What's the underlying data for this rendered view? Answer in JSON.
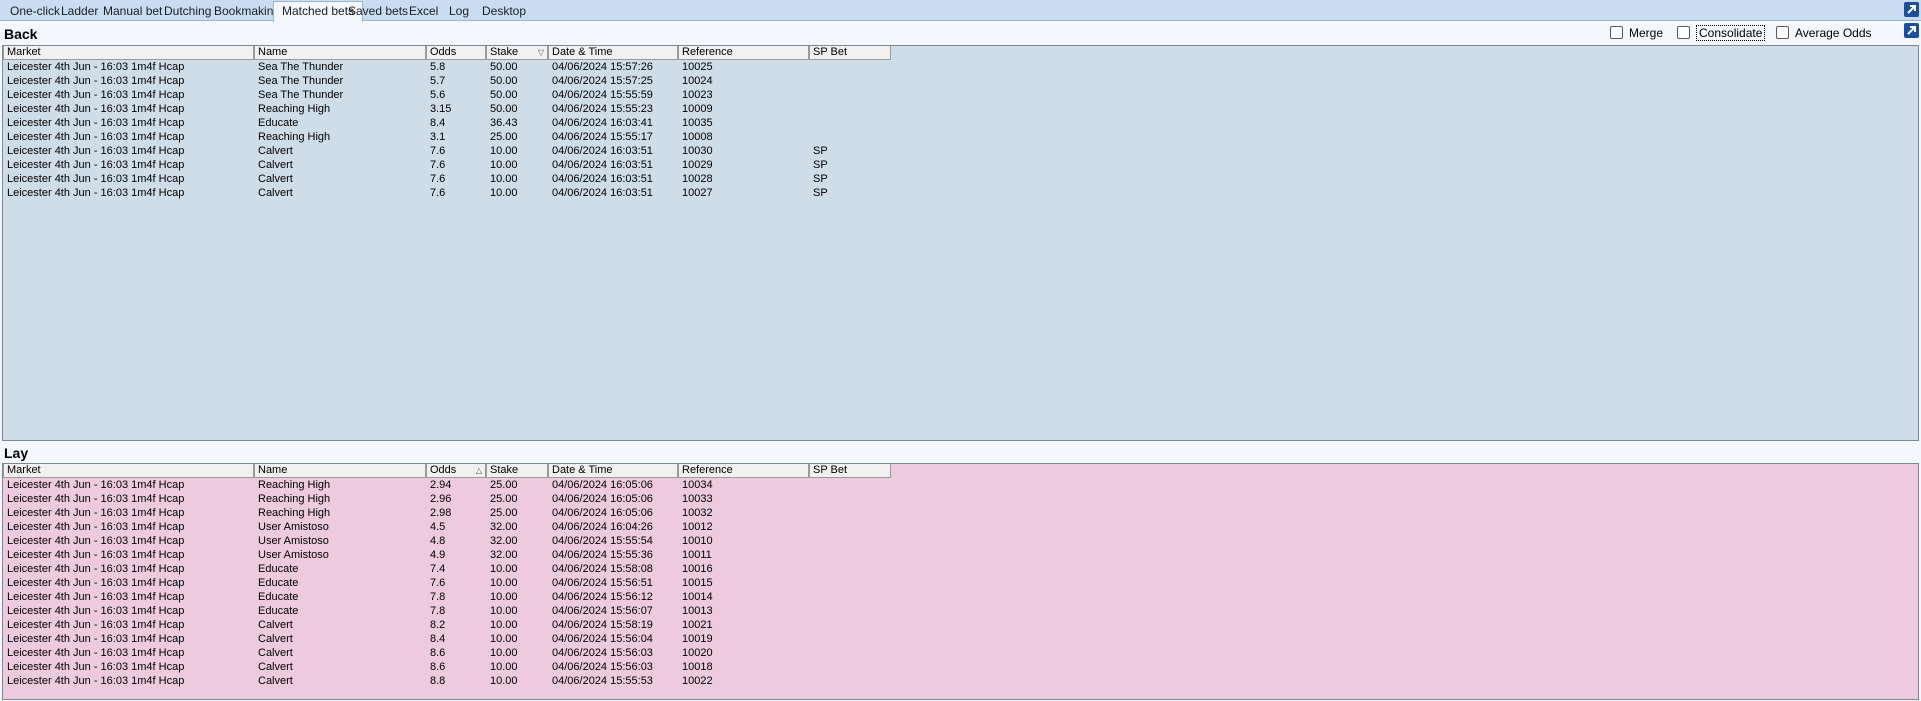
{
  "tabs": [
    {
      "label": "One-click",
      "active": false
    },
    {
      "label": "Ladder",
      "active": false
    },
    {
      "label": "Manual bet",
      "active": false
    },
    {
      "label": "Dutching",
      "active": false
    },
    {
      "label": "Bookmaking",
      "active": false
    },
    {
      "label": "Matched bets",
      "active": true
    },
    {
      "label": "Saved bets",
      "active": false
    },
    {
      "label": "Excel",
      "active": false
    },
    {
      "label": "Log",
      "active": false
    },
    {
      "label": "Desktop",
      "active": false
    }
  ],
  "options": {
    "merge": "Merge",
    "consolidate": "Consolidate",
    "average_odds": "Average Odds"
  },
  "columns": [
    "Market",
    "Name",
    "Odds",
    "Stake",
    "Date & Time",
    "Reference",
    "SP Bet"
  ],
  "back": {
    "title": "Back",
    "sort_column": "Stake",
    "rows": [
      [
        "Leicester 4th Jun - 16:03 1m4f Hcap",
        "Sea The Thunder",
        "5.8",
        "50.00",
        "04/06/2024 15:57:26",
        "10025",
        ""
      ],
      [
        "Leicester 4th Jun - 16:03 1m4f Hcap",
        "Sea The Thunder",
        "5.7",
        "50.00",
        "04/06/2024 15:57:25",
        "10024",
        ""
      ],
      [
        "Leicester 4th Jun - 16:03 1m4f Hcap",
        "Sea The Thunder",
        "5.6",
        "50.00",
        "04/06/2024 15:55:59",
        "10023",
        ""
      ],
      [
        "Leicester 4th Jun - 16:03 1m4f Hcap",
        "Reaching High",
        "3.15",
        "50.00",
        "04/06/2024 15:55:23",
        "10009",
        ""
      ],
      [
        "Leicester 4th Jun - 16:03 1m4f Hcap",
        "Educate",
        "8.4",
        "36.43",
        "04/06/2024 16:03:41",
        "10035",
        ""
      ],
      [
        "Leicester 4th Jun - 16:03 1m4f Hcap",
        "Reaching High",
        "3.1",
        "25.00",
        "04/06/2024 15:55:17",
        "10008",
        ""
      ],
      [
        "Leicester 4th Jun - 16:03 1m4f Hcap",
        "Calvert",
        "7.6",
        "10.00",
        "04/06/2024 16:03:51",
        "10030",
        "SP"
      ],
      [
        "Leicester 4th Jun - 16:03 1m4f Hcap",
        "Calvert",
        "7.6",
        "10.00",
        "04/06/2024 16:03:51",
        "10029",
        "SP"
      ],
      [
        "Leicester 4th Jun - 16:03 1m4f Hcap",
        "Calvert",
        "7.6",
        "10.00",
        "04/06/2024 16:03:51",
        "10028",
        "SP"
      ],
      [
        "Leicester 4th Jun - 16:03 1m4f Hcap",
        "Calvert",
        "7.6",
        "10.00",
        "04/06/2024 16:03:51",
        "10027",
        "SP"
      ]
    ]
  },
  "lay": {
    "title": "Lay",
    "sort_column": "Odds",
    "rows": [
      [
        "Leicester 4th Jun - 16:03 1m4f Hcap",
        "Reaching High",
        "2.94",
        "25.00",
        "04/06/2024 16:05:06",
        "10034",
        ""
      ],
      [
        "Leicester 4th Jun - 16:03 1m4f Hcap",
        "Reaching High",
        "2.96",
        "25.00",
        "04/06/2024 16:05:06",
        "10033",
        ""
      ],
      [
        "Leicester 4th Jun - 16:03 1m4f Hcap",
        "Reaching High",
        "2.98",
        "25.00",
        "04/06/2024 16:05:06",
        "10032",
        ""
      ],
      [
        "Leicester 4th Jun - 16:03 1m4f Hcap",
        "User Amistoso",
        "4.5",
        "32.00",
        "04/06/2024 16:04:26",
        "10012",
        ""
      ],
      [
        "Leicester 4th Jun - 16:03 1m4f Hcap",
        "User Amistoso",
        "4.8",
        "32.00",
        "04/06/2024 15:55:54",
        "10010",
        ""
      ],
      [
        "Leicester 4th Jun - 16:03 1m4f Hcap",
        "User Amistoso",
        "4.9",
        "32.00",
        "04/06/2024 15:55:36",
        "10011",
        ""
      ],
      [
        "Leicester 4th Jun - 16:03 1m4f Hcap",
        "Educate",
        "7.4",
        "10.00",
        "04/06/2024 15:58:08",
        "10016",
        ""
      ],
      [
        "Leicester 4th Jun - 16:03 1m4f Hcap",
        "Educate",
        "7.6",
        "10.00",
        "04/06/2024 15:56:51",
        "10015",
        ""
      ],
      [
        "Leicester 4th Jun - 16:03 1m4f Hcap",
        "Educate",
        "7.8",
        "10.00",
        "04/06/2024 15:56:12",
        "10014",
        ""
      ],
      [
        "Leicester 4th Jun - 16:03 1m4f Hcap",
        "Educate",
        "7.8",
        "10.00",
        "04/06/2024 15:56:07",
        "10013",
        ""
      ],
      [
        "Leicester 4th Jun - 16:03 1m4f Hcap",
        "Calvert",
        "8.2",
        "10.00",
        "04/06/2024 15:58:19",
        "10021",
        ""
      ],
      [
        "Leicester 4th Jun - 16:03 1m4f Hcap",
        "Calvert",
        "8.4",
        "10.00",
        "04/06/2024 15:56:04",
        "10019",
        ""
      ],
      [
        "Leicester 4th Jun - 16:03 1m4f Hcap",
        "Calvert",
        "8.6",
        "10.00",
        "04/06/2024 15:56:03",
        "10020",
        ""
      ],
      [
        "Leicester 4th Jun - 16:03 1m4f Hcap",
        "Calvert",
        "8.6",
        "10.00",
        "04/06/2024 15:56:03",
        "10018",
        ""
      ],
      [
        "Leicester 4th Jun - 16:03 1m4f Hcap",
        "Calvert",
        "8.8",
        "10.00",
        "04/06/2024 15:55:53",
        "10022",
        ""
      ]
    ]
  },
  "colors": {
    "back_bg": "#cfdde9",
    "lay_bg": "#eecbdc",
    "tabbar_bg": "#c9dcf2",
    "corner_button": "#1b4f9c"
  },
  "icons": {
    "popout": "arrow-up-right-icon",
    "sort": "sort-arrow-icon"
  }
}
